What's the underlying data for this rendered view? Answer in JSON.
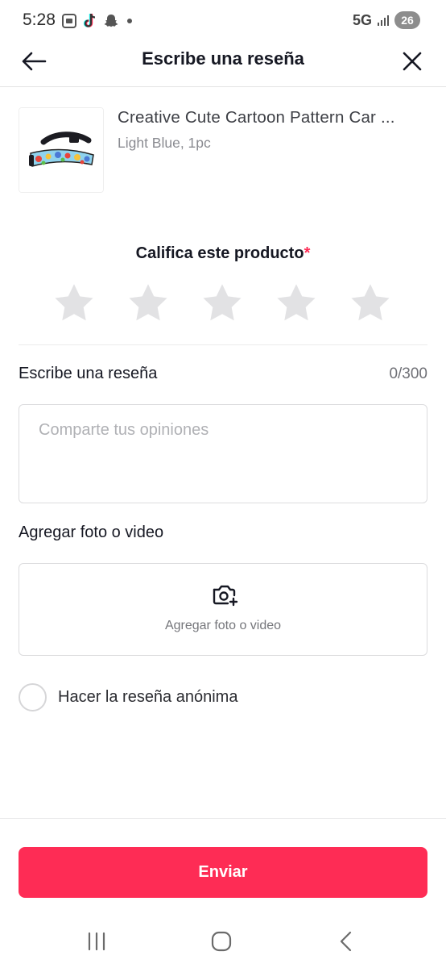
{
  "status_bar": {
    "time": "5:28",
    "network": "5G",
    "battery": "26",
    "icons": [
      "screenshot-icon",
      "tiktok-icon",
      "snapchat-icon",
      "dot-icon",
      "signal-icon",
      "battery-icon"
    ]
  },
  "header": {
    "title": "Escribe una reseña",
    "back_icon": "arrow-left-icon",
    "close_icon": "close-icon"
  },
  "product": {
    "name": "Creative Cute Cartoon Pattern Car ...",
    "variant": "Light Blue, 1pc",
    "thumbnail": "product-thumbnail-image"
  },
  "rating": {
    "title": "Califica este producto",
    "required_mark": "*",
    "max_stars": 5,
    "selected": 0
  },
  "review": {
    "label": "Escribe una reseña",
    "counter": "0/300",
    "value": "",
    "placeholder": "Comparte tus opiniones"
  },
  "media": {
    "label": "Agregar foto o video",
    "button_text": "Agregar foto o video",
    "icon": "camera-plus-icon"
  },
  "anonymous": {
    "label": "Hacer la reseña anónima",
    "checked": false
  },
  "submit": {
    "label": "Enviar"
  },
  "colors": {
    "accent": "#fe2c55",
    "star_empty": "#e2e2e4",
    "text_primary": "#161823",
    "text_secondary": "#8a8b91"
  },
  "system_nav": {
    "icons": [
      "recent-apps-icon",
      "home-icon",
      "back-icon"
    ]
  }
}
